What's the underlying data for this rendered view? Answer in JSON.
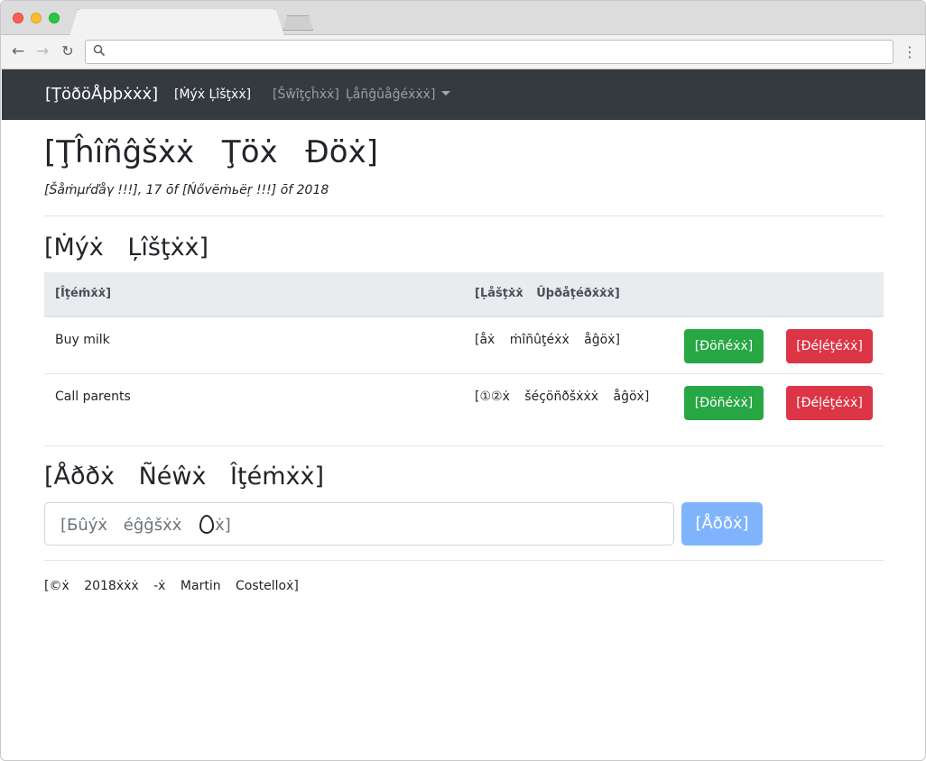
{
  "browser": {
    "url": ""
  },
  "navbar": {
    "brand": "[ŢöðöÅþþẋẋẋ]",
    "my_lists": "[Ṁýẋ Ļîšţẋẋ]",
    "switch": "[Šŵîţçĥẋẋ]",
    "language": "Ļåñĝûåĝéẋẋẋ]"
  },
  "header": {
    "title": "[Ţĥîñĝšẋẋ Ţöẋ Ðöẋ]",
    "date": "[Šåṁµŕďåγ !!!], 17 ōf [Ńővëṁьëŗ !!!] ōf 2018"
  },
  "lists_section": {
    "title": "[Ṁýẋ Ļîšţẋẋ]",
    "columns": [
      "[Îţéṁẋẋ]",
      "[Ļåšţẋẋ Ûþðåţéðẋẋẋ]"
    ],
    "rows": [
      {
        "name": "Buy milk",
        "updated": "[åẋ ṁîñûţéẋẋ åĝöẋ]",
        "done_label": "[Ðöñéẋẋ]",
        "delete_label": "[Ðéļéţéẋẋ]"
      },
      {
        "name": "Call parents",
        "updated": "[①②ẋ šéçöñðšẋẋẋ åĝöẋ]",
        "done_label": "[Ðöñéẋẋ]",
        "delete_label": "[Ðéļéţéẋẋ]"
      }
    ]
  },
  "add_section": {
    "title": "[Åððẋ Ñéŵẋ Îţéṁẋẋ]",
    "placeholder_before": "[Бûýẋ éĝĝšẋẋ",
    "placeholder_after": "ẋ]",
    "button": "[Åððẋ]"
  },
  "footer": {
    "text": "[©ẋ 2018ẋẋẋ -ẋ Martin Costelloẋ]"
  }
}
